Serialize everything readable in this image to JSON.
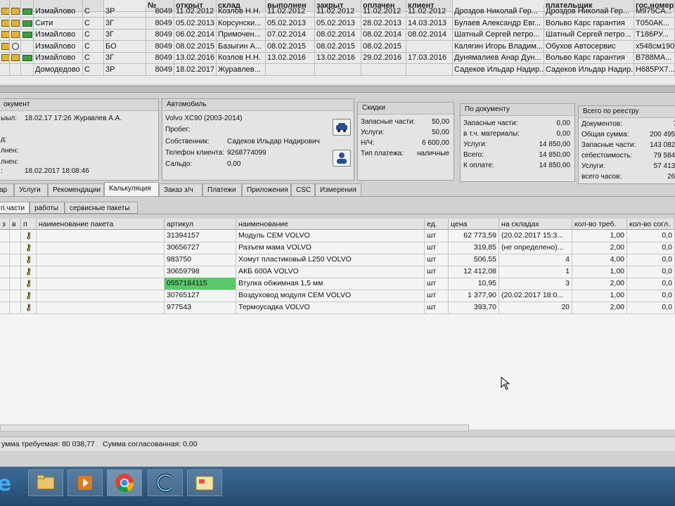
{
  "top_grid": {
    "headers": [
      "",
      "",
      "",
      "",
      "",
      "№",
      "открыт",
      "склад",
      "выполнен",
      "закрыт",
      "оплачен",
      "клиент",
      "плательщик",
      "гос.номер"
    ],
    "rows": [
      {
        "branch": "Измайлово",
        "t": "С",
        "code": "3Р",
        "num": "8049",
        "opened": "11.02.2012",
        "warehouse": "Козлов Н.Н.",
        "done": "11.02.2012",
        "done2": "11.02.2012",
        "closed": "11.02.2012",
        "paid": "11.02.2012",
        "client": "Дроздов Николай Гер...",
        "payer": "Дроздов Николай Гер...",
        "plate": "М975СА..."
      },
      {
        "branch": "Сити",
        "t": "С",
        "code": "3Г",
        "num": "8049",
        "opened": "05.02.2013",
        "warehouse": "Корсунски...",
        "done": "05.02.2013",
        "done2": "05.02.2013",
        "closed": "28.02.2013",
        "paid": "14.03.2013",
        "client": "Булаев Александр Евг...",
        "payer": "Вольво Карс гарантия",
        "plate": "Т050АК..."
      },
      {
        "branch": "Измайлово",
        "t": "С",
        "code": "3Г",
        "num": "8049",
        "opened": "06.02.2014",
        "warehouse": "Примочен...",
        "done": "07.02.2014",
        "done2": "08.02.2014",
        "closed": "08.02.2014",
        "paid": "08.02.2014",
        "client": "Шатный Сергей петро...",
        "payer": "Шатный Сергей петро...",
        "plate": "Т186РУ..."
      },
      {
        "branch": "Измайлово",
        "t": "С",
        "code": "БО",
        "num": "8049",
        "opened": "08.02.2015",
        "warehouse": "Базыгин А...",
        "done": "08.02.2015",
        "done2": "08.02.2015",
        "closed": "08.02.2015",
        "paid": "",
        "client": "Калягин Игорь Владим...",
        "payer": "Обухов Автосервис",
        "plate": "х548см190"
      },
      {
        "branch": "Измайлово",
        "t": "С",
        "code": "3Г",
        "num": "8049",
        "opened": "13.02.2016",
        "warehouse": "Козлов Н.Н.",
        "done": "13.02.2016",
        "done2": "13.02.2016",
        "closed": "29.02.2016",
        "paid": "17.03.2016",
        "client": "Дунямалиев Анар Дун...",
        "payer": "Вольво Карс гарантия",
        "plate": "В788МА..."
      },
      {
        "branch": "Домодедово",
        "t": "С",
        "code": "3Р",
        "num": "8049",
        "opened": "18.02.2017",
        "warehouse": "Журавлев...",
        "done": "",
        "done2": "",
        "closed": "",
        "paid": "",
        "client": "Садеков Ильдар Надир...",
        "payer": "Садеков Ильдар Надир...",
        "plate": "Н685РХ7..."
      }
    ]
  },
  "doc_panel": {
    "title": "окумент",
    "rows": [
      {
        "label": "ыыл:",
        "value": "18.02.17  17:26 Журавлев А.А."
      },
      {
        "label": "д:",
        "value": ""
      },
      {
        "label": "лнен:",
        "value": ""
      },
      {
        "label": "лнен:",
        "value": ""
      },
      {
        "label": ":",
        "value": "18.02.2017 18:08:46"
      }
    ]
  },
  "car_panel": {
    "title": "Автомобиль",
    "model": "Volvo XC90 (2003-2014)",
    "mileage_label": "Пробег:",
    "owner_label": "Собственник:",
    "owner_value": "Садеков Ильдар Надирович",
    "phone_label": "Телефон клиента:",
    "phone_value": "9268774099",
    "balance_label": "Сальдо:",
    "balance_value": "0,00"
  },
  "discounts_panel": {
    "title": "Скидки",
    "rows": [
      {
        "label": "Запасные части:",
        "value": "50,00"
      },
      {
        "label": "Услуги:",
        "value": "50,00"
      },
      {
        "label": "Н/Ч:",
        "value": "6 600,00"
      },
      {
        "label": "Тип платежа:",
        "value": "наличные"
      }
    ]
  },
  "bydoc_panel": {
    "title": "По документу",
    "rows": [
      {
        "label": "Запасные части:",
        "value": "0,00"
      },
      {
        "label": "в т.ч. материалы:",
        "value": "0,00"
      },
      {
        "label": "Услуги:",
        "value": "14 850,00"
      },
      {
        "label": "Всего:",
        "value": "14 850,00"
      },
      {
        "label": "К оплате:",
        "value": "14 850,00"
      }
    ]
  },
  "registry_panel": {
    "title": "Всего по реестру",
    "rows": [
      {
        "label": "Документов:",
        "value": "7"
      },
      {
        "label": "Общая сумма:",
        "value": "200 495,"
      },
      {
        "label": "Запасные части:",
        "value": "143 082,"
      },
      {
        "label": "себестоимость:",
        "value": "79 584,"
      },
      {
        "label": "Услуги:",
        "value": "57 413,"
      },
      {
        "label": "всего часов:",
        "value": "26,"
      }
    ]
  },
  "tabs": [
    "ар",
    "Услуги",
    "Рекомендации",
    "Калькуляция",
    "Заказ з/ч",
    "Платежи",
    "Приложения",
    "CSC",
    "Измерения"
  ],
  "active_tab": "Калькуляция",
  "subtabs": [
    "п.части",
    "работы",
    "сервисные пакеты"
  ],
  "parts_table": {
    "headers": [
      "з",
      "в",
      "п",
      "наименование пакета",
      "артикул",
      "наименование",
      "ед.",
      "цена",
      "на складах",
      "кол-во треб.",
      "кол-во согл."
    ],
    "rows": [
      {
        "article": "31394157",
        "name": "Модуль CEM VOLVO",
        "unit": "шт",
        "price": "62 773,59",
        "stock": "(20.02.2017 15:3...",
        "qty_req": "1,00",
        "qty_agr": "0,0"
      },
      {
        "article": "30656727",
        "name": "Разъем мама VOLVO",
        "unit": "шт",
        "price": "319,85",
        "stock": "(не определено)...",
        "qty_req": "2,00",
        "qty_agr": "0,0"
      },
      {
        "article": "983750",
        "name": "Хомут пластиковый L250 VOLVO",
        "unit": "шт",
        "price": "506,55",
        "stock": "4",
        "qty_req": "4,00",
        "qty_agr": "0,0"
      },
      {
        "article": "30659798",
        "name": "АКБ 600А  VOLVO",
        "unit": "шт",
        "price": "12 412,08",
        "stock": "1",
        "qty_req": "1,00",
        "qty_agr": "0,0"
      },
      {
        "article": "0557184115",
        "name": "Втулка обжимная 1,5 мм",
        "unit": "шт",
        "price": "10,95",
        "stock": "3",
        "qty_req": "2,00",
        "qty_agr": "0,0"
      },
      {
        "article": "30765127",
        "name": "Воздуховод модуля CEM VOLVO",
        "unit": "шт",
        "price": "1 377,90",
        "stock": "(20.02.2017 18:0...",
        "qty_req": "1,00",
        "qty_agr": "0,0"
      },
      {
        "article": "977543",
        "name": "Термоусадка VOLVO",
        "unit": "шт",
        "price": "393,70",
        "stock": "20",
        "qty_req": "2,00",
        "qty_agr": "0,0"
      }
    ]
  },
  "status": {
    "required_sum": "умма требуемая: 80 038,77",
    "agreed_sum": "Сумма согласованная: 0,00"
  },
  "taskbar": [
    "ie-icon",
    "explorer-icon",
    "media-icon",
    "chrome-icon",
    "app-icon",
    "folder-app-icon"
  ]
}
